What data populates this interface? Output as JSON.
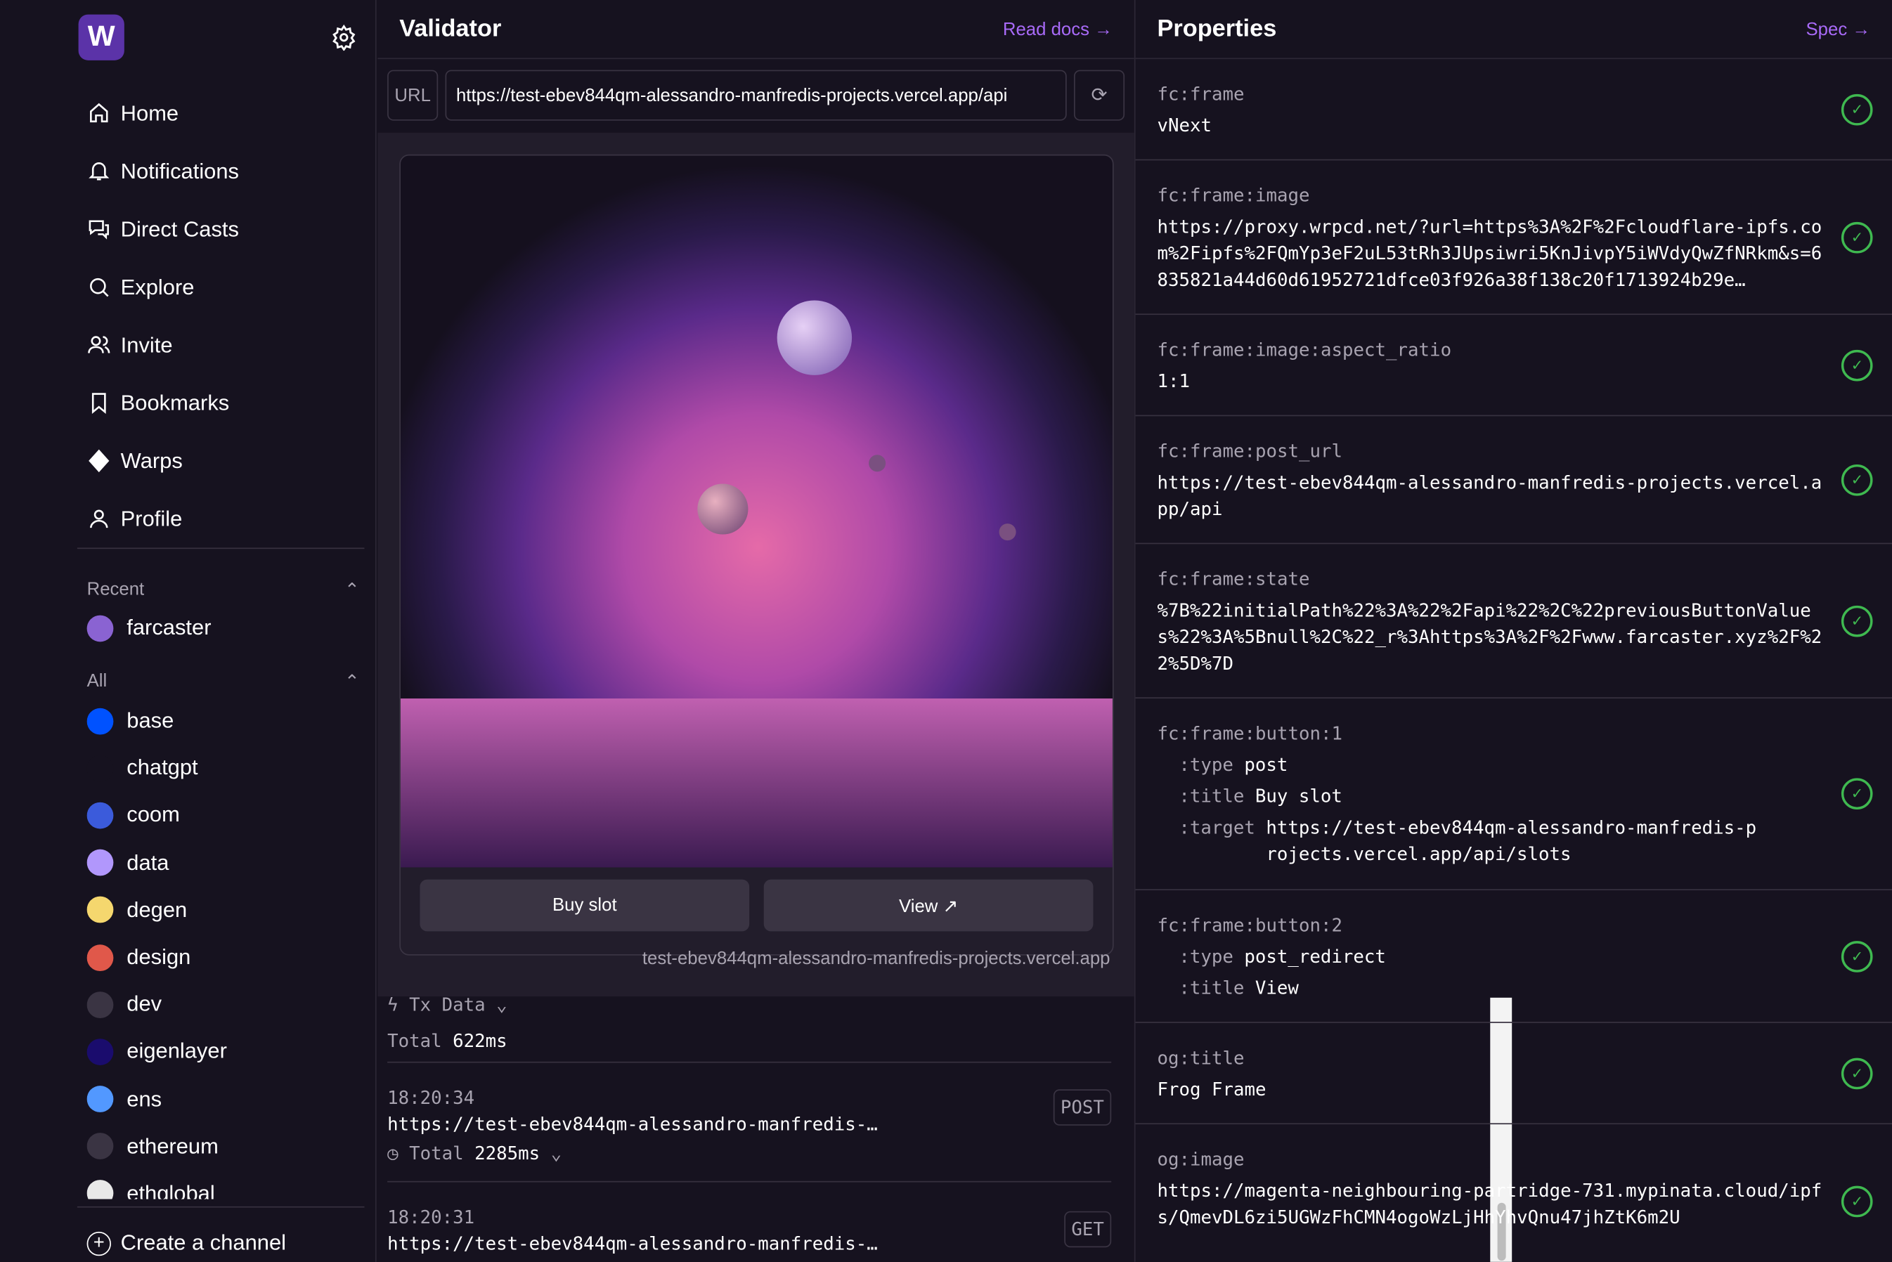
{
  "sidebar": {
    "logo": "W",
    "nav": [
      {
        "label": "Home",
        "icon": "home-icon"
      },
      {
        "label": "Notifications",
        "icon": "bell-icon"
      },
      {
        "label": "Direct Casts",
        "icon": "chat-icon"
      },
      {
        "label": "Explore",
        "icon": "search-icon"
      },
      {
        "label": "Invite",
        "icon": "users-icon"
      },
      {
        "label": "Bookmarks",
        "icon": "bookmark-icon"
      },
      {
        "label": "Warps",
        "icon": "diamond-icon"
      },
      {
        "label": "Profile",
        "icon": "user-icon"
      }
    ],
    "recent_label": "Recent",
    "recent": [
      {
        "name": "farcaster",
        "color": "#8a63d2"
      }
    ],
    "all_label": "All",
    "channels": [
      {
        "name": "base",
        "color": "#0052ff"
      },
      {
        "name": "chatgpt",
        "color": "#16121f"
      },
      {
        "name": "coom",
        "color": "#3b5bdb"
      },
      {
        "name": "data",
        "color": "#b197fc"
      },
      {
        "name": "degen",
        "color": "#f5d76e"
      },
      {
        "name": "design",
        "color": "#e0584a"
      },
      {
        "name": "dev",
        "color": "#3a3443"
      },
      {
        "name": "eigenlayer",
        "color": "#1a0c6d"
      },
      {
        "name": "ens",
        "color": "#5298ff"
      },
      {
        "name": "ethereum",
        "color": "#3a3443"
      },
      {
        "name": "ethglobal",
        "color": "#e8e8e8"
      }
    ],
    "create_label": "Create a channel"
  },
  "validator": {
    "title": "Validator",
    "docs_link": "Read docs →",
    "url_label": "URL",
    "url_value": "https://test-ebev844qm-alessandro-manfredis-projects.vercel.app/api",
    "buttons": [
      "Buy slot",
      "View ↗"
    ],
    "domain": "test-ebev844qm-alessandro-manfredis-projects.vercel.app",
    "log": {
      "tx_label": "Tx Data",
      "total_label": "Total",
      "total_value": "622ms",
      "entries": [
        {
          "time": "18:20:34",
          "url": "https://test-ebev844qm-alessandro-manfredis-…",
          "method": "POST",
          "total_label": "Total",
          "total": "2285ms"
        },
        {
          "time": "18:20:31",
          "url": "https://test-ebev844qm-alessandro-manfredis-…",
          "method": "GET"
        }
      ]
    }
  },
  "properties": {
    "title": "Properties",
    "spec_link": "Spec →",
    "items": [
      {
        "key": "fc:frame",
        "value": "vNext"
      },
      {
        "key": "fc:frame:image",
        "value": "https://proxy.wrpcd.net/?url=https%3A%2F%2Fcloudflare-ipfs.com%2Fipfs%2FQmYp3eF2uL53tRh3JUpsiwri5KnJivpY5iWVdyQwZfNRkm&s=6835821a44d60d61952721dfce03f926a38f138c20f1713924b29e…"
      },
      {
        "key": "fc:frame:image:aspect_ratio",
        "value": "1:1"
      },
      {
        "key": "fc:frame:post_url",
        "value": "https://test-ebev844qm-alessandro-manfredis-projects.vercel.app/api"
      },
      {
        "key": "fc:frame:state",
        "value": "%7B%22initialPath%22%3A%22%2Fapi%22%2C%22previousButtonValues%22%3A%5Bnull%2C%22_r%3Ahttps%3A%2F%2Fwww.farcaster.xyz%2F%22%5D%7D"
      }
    ],
    "button1": {
      "key": "fc:frame:button:1",
      "type_k": ":type",
      "type": "post",
      "title_k": ":title",
      "title": "Buy slot",
      "target_k": ":target",
      "target": "https://test-ebev844qm-alessandro-manfredis-projects.vercel.app/api/slots"
    },
    "button2": {
      "key": "fc:frame:button:2",
      "type_k": ":type",
      "type": "post_redirect",
      "title_k": ":title",
      "title": "View"
    },
    "og": [
      {
        "key": "og:title",
        "value": "Frog Frame"
      },
      {
        "key": "og:image",
        "value": "https://magenta-neighbouring-partridge-731.mypinata.cloud/ipfs/QmevDL6zi5UGWzFhCMN4ogoWzLjHhYhvQnu47jhZtK6m2U"
      }
    ],
    "status_color": "#3fb950"
  }
}
